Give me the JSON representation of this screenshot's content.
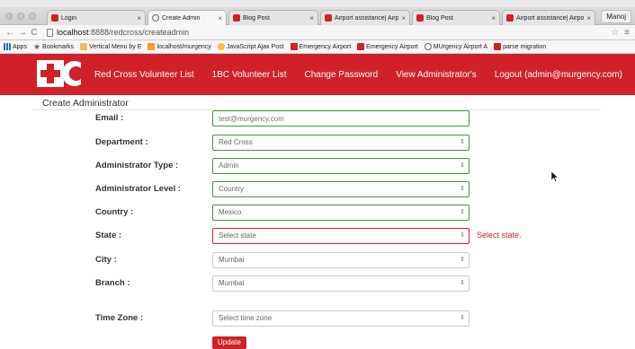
{
  "browser": {
    "tabs": [
      {
        "label": "Login",
        "icon": "red-favicon"
      },
      {
        "label": "Create Admin",
        "icon": "globe-favicon"
      },
      {
        "label": "Blog Post",
        "icon": "red-favicon"
      },
      {
        "label": "Airport assistance| Airpo",
        "icon": "red-favicon"
      },
      {
        "label": "Blog Post",
        "icon": "red-favicon"
      },
      {
        "label": "Airport assistance| Airpo",
        "icon": "red-favicon"
      }
    ],
    "user_chip": "Manoj",
    "url_host": "localhost",
    "url_path": ":8888/redcross/createadmin",
    "bookmarks": [
      {
        "label": "Apps",
        "icon": "apps"
      },
      {
        "label": "Bookmarks",
        "icon": "star"
      },
      {
        "label": "Vertical Menu by E",
        "icon": "folder"
      },
      {
        "label": "localhost/murgency",
        "icon": "orange"
      },
      {
        "label": "JavaScript Ajax Post",
        "icon": "yellow"
      },
      {
        "label": "Emergency Airport",
        "icon": "red"
      },
      {
        "label": "Emergency Airport",
        "icon": "red"
      },
      {
        "label": "MUrgency Airport A",
        "icon": "gray"
      },
      {
        "label": "parse migration",
        "icon": "red"
      }
    ]
  },
  "header": {
    "brand_color": "#d0212a",
    "nav": [
      "Red Cross Volunteer List",
      "1BC Volunteer List",
      "Change Password",
      "View Administrator's",
      "Logout (admin@murgency.com)"
    ]
  },
  "page": {
    "title": "Create Administrator"
  },
  "form": {
    "email": {
      "label": "Email :",
      "placeholder": "test@murgency.com"
    },
    "department": {
      "label": "Department :",
      "value": "Red Cross"
    },
    "admin_type": {
      "label": "Administrator Type :",
      "value": "Admin"
    },
    "admin_level": {
      "label": "Administrator Level :",
      "value": "Country"
    },
    "country": {
      "label": "Country :",
      "value": "Mexico"
    },
    "state": {
      "label": "State :",
      "value": "Select state",
      "error": "Select state."
    },
    "city": {
      "label": "City :",
      "value": "Mumbai"
    },
    "branch": {
      "label": "Branch :",
      "value": "Mumbai"
    },
    "timezone": {
      "label": "Time Zone :",
      "value": "Select time zone"
    },
    "submit_label": "Update"
  }
}
